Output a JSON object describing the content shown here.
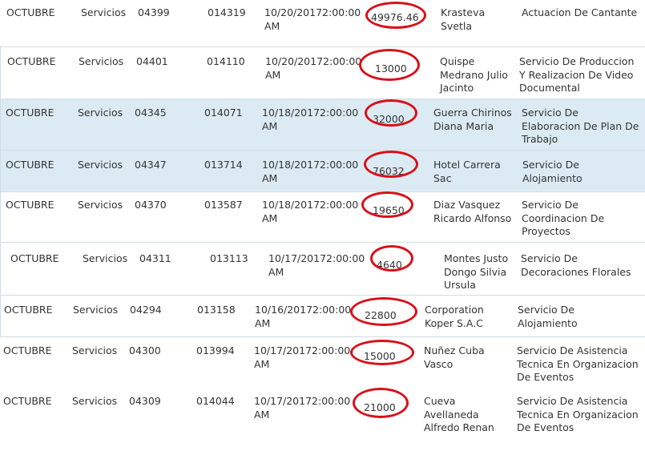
{
  "accent": "#d8101a",
  "row_highlight": "#dcebf3",
  "rows": [
    {
      "month": "OCTUBRE",
      "type": "Servicios",
      "doc": "04399",
      "code": "014319",
      "date": [
        "10/20/20172:00:00",
        "AM"
      ],
      "amount": "49976.46",
      "provider": [
        "Krasteva",
        "Svetla"
      ],
      "description": [
        "Actuacion De Cantante"
      ]
    },
    {
      "month": "OCTUBRE",
      "type": "Servicios",
      "doc": "04401",
      "code": "014110",
      "date": [
        "10/20/20172:00:00",
        "AM"
      ],
      "amount": "13000",
      "provider": [
        "Quispe",
        "Medrano Julio",
        "Jacinto"
      ],
      "description": [
        "Servicio De Produccion",
        "Y Realizacion De Video",
        "Documental"
      ]
    },
    {
      "month": "OCTUBRE",
      "type": "Servicios",
      "doc": "04345",
      "code": "014071",
      "date": [
        "10/18/20172:00:00",
        "AM"
      ],
      "amount": "32000",
      "provider": [
        "Guerra Chirinos",
        "Diana Maria"
      ],
      "description": [
        "Servicio De",
        "Elaboracion De Plan De",
        "Trabajo"
      ]
    },
    {
      "month": "OCTUBRE",
      "type": "Servicios",
      "doc": "04347",
      "code": "013714",
      "date": [
        "10/18/20172:00:00",
        "AM"
      ],
      "amount": "76032",
      "provider": [
        "Hotel Carrera",
        "Sac"
      ],
      "description": [
        "Servicio De",
        "Alojamiento"
      ]
    },
    {
      "month": "OCTUBRE",
      "type": "Servicios",
      "doc": "04370",
      "code": "013587",
      "date": [
        "10/18/20172:00:00",
        "AM"
      ],
      "amount": "19650",
      "provider": [
        "Diaz Vasquez",
        "Ricardo Alfonso"
      ],
      "description": [
        "Servicio De",
        "Coordinacion De",
        "Proyectos"
      ]
    },
    {
      "month": "OCTUBRE",
      "type": "Servicios",
      "doc": "04311",
      "code": "013113",
      "date": [
        "10/17/20172:00:00",
        "AM"
      ],
      "amount": "4640",
      "provider": [
        "Montes Justo",
        "Dongo Silvia",
        "Ursula"
      ],
      "description": [
        "Servicio De",
        "Decoraciones Florales"
      ]
    },
    {
      "month": "OCTUBRE",
      "type": "Servicios",
      "doc": "04294",
      "code": "013158",
      "date": [
        "10/16/20172:00:00",
        "AM"
      ],
      "amount": "22800",
      "provider": [
        "Corporation",
        "Koper S.A.C"
      ],
      "description": [
        "Servicio De",
        "Alojamiento"
      ]
    },
    {
      "month": "OCTUBRE",
      "type": "Servicios",
      "doc": "04300",
      "code": "013994",
      "date": [
        "10/17/20172:00:00",
        "AM"
      ],
      "amount": "15000",
      "provider": [
        "Nuñez Cuba",
        "Vasco"
      ],
      "description": [
        "Servicio De Asistencia",
        "Tecnica En Organizacion",
        "De Eventos"
      ]
    },
    {
      "month": "OCTUBRE",
      "type": "Servicios",
      "doc": "04309",
      "code": "014044",
      "date": [
        "10/17/20172:00:00",
        "AM"
      ],
      "amount": "21000",
      "provider": [
        "Cueva",
        "Avellaneda",
        "Alfredo Renan"
      ],
      "description": [
        "Servicio De Asistencia",
        "Tecnica En Organizacion",
        "De Eventos"
      ]
    }
  ]
}
